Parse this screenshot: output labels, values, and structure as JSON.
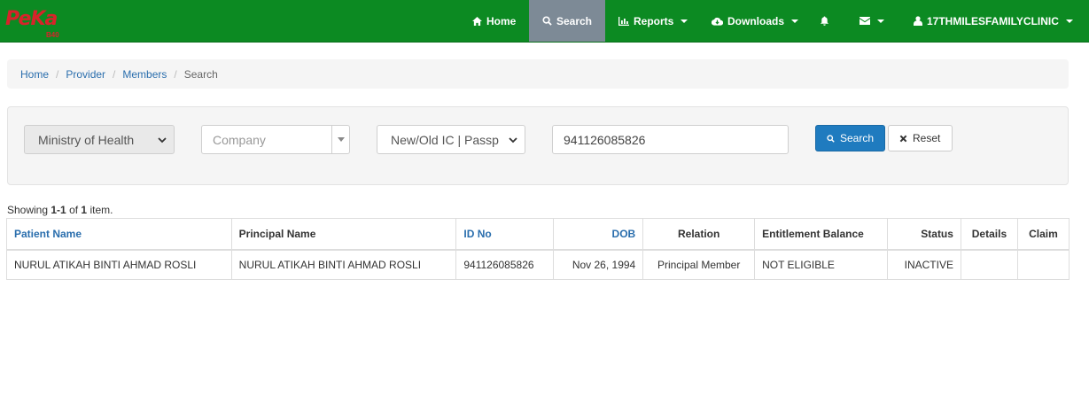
{
  "brand": {
    "logo_text": "PeKa",
    "logo_sub": "B40"
  },
  "nav": {
    "home": "Home",
    "search": "Search",
    "reports": "Reports",
    "downloads": "Downloads",
    "user": "17THMILESFAMILYCLINIC"
  },
  "breadcrumb": {
    "home": "Home",
    "provider": "Provider",
    "members": "Members",
    "current": "Search",
    "separator": "/"
  },
  "filters": {
    "agency": "Ministry of Health",
    "company_placeholder": "Company",
    "id_type": "New/Old IC | Passp",
    "id_value": "941126085826",
    "search_label": "Search",
    "reset_label": "Reset"
  },
  "summary": {
    "prefix": "Showing",
    "range": "1-1",
    "of": "of",
    "total": "1",
    "suffix": "item."
  },
  "table": {
    "headers": {
      "patient_name": "Patient Name",
      "principal_name": "Principal Name",
      "id_no": "ID No",
      "dob": "DOB",
      "relation": "Relation",
      "entitlement_balance": "Entitlement Balance",
      "status": "Status",
      "details": "Details",
      "claim": "Claim"
    },
    "rows": [
      {
        "patient_name": "NURUL ATIKAH BINTI AHMAD ROSLI",
        "principal_name": "NURUL ATIKAH BINTI AHMAD ROSLI",
        "id_no": "941126085826",
        "dob": "Nov 26, 1994",
        "relation": "Principal Member",
        "entitlement_balance": "NOT ELIGIBLE",
        "status": "INACTIVE",
        "details": "",
        "claim": ""
      }
    ]
  },
  "icons": {
    "home": "home-icon",
    "search": "search-icon",
    "reports": "bar-chart-icon",
    "downloads": "cloud-download-icon",
    "notifications": "bell-icon",
    "messages": "envelope-icon",
    "user": "user-icon",
    "reset": "close-icon"
  },
  "colors": {
    "navbar": "#0c8a22",
    "active_nav": "#7d8a96",
    "link": "#2a6ead",
    "primary_button": "#1f7bbf",
    "logo": "#d8232a"
  }
}
